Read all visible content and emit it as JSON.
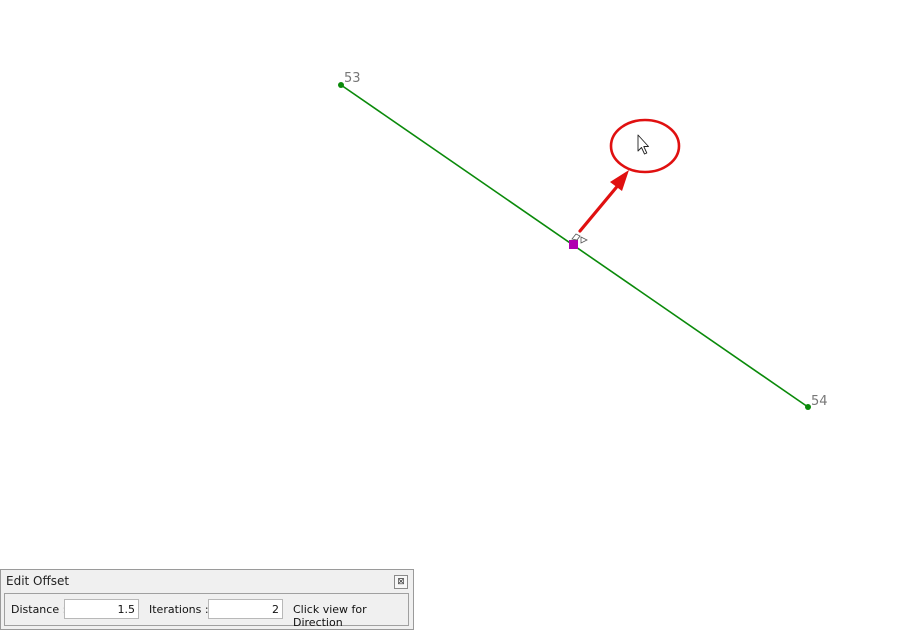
{
  "canvas": {
    "point_a_label": "53",
    "point_b_label": "54",
    "line_color": "#0a8a0a",
    "midpoint_marker_color": "#b000b0",
    "annotation_color": "#e01010"
  },
  "panel": {
    "title": "Edit Offset",
    "close_glyph": "⊠",
    "distance_label": "Distance :",
    "distance_value": "1.5",
    "iterations_label": "Iterations :",
    "iterations_value": "2",
    "hint": "Click view for Direction"
  }
}
